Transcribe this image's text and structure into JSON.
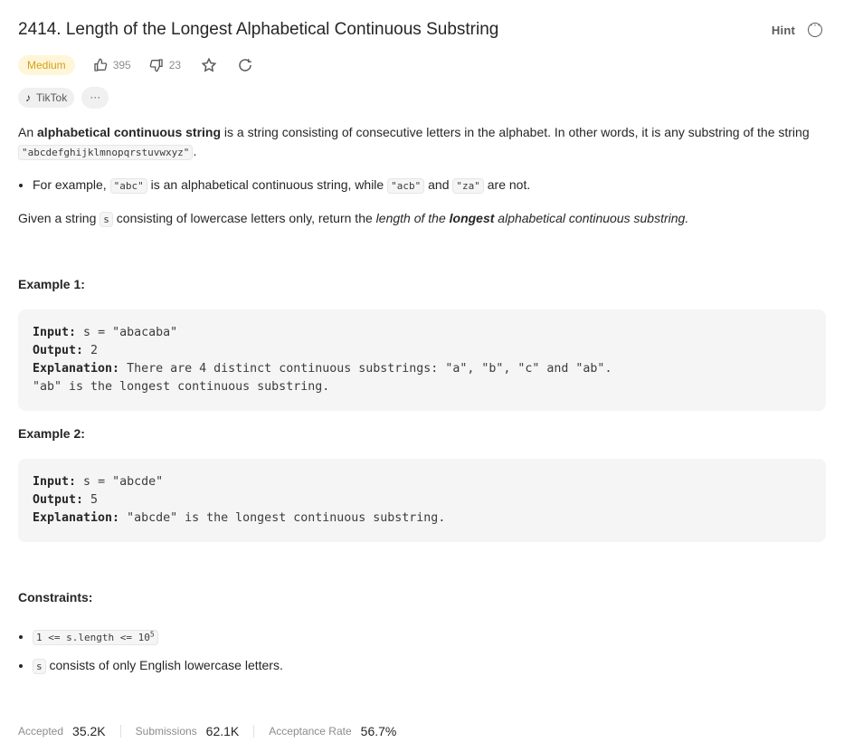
{
  "problem": {
    "title": "2414. Length of the Longest Alphabetical Continuous Substring",
    "hint_label": "Hint",
    "difficulty": "Medium",
    "likes": "395",
    "dislikes": "23",
    "tags": [
      "TikTok"
    ],
    "tag_more": "···"
  },
  "description": {
    "p1_a": "An ",
    "p1_bold": "alphabetical continuous string",
    "p1_b": " is a string consisting of consecutive letters in the alphabet. In other words, it is any substring of the string ",
    "p1_code": "\"abcdefghijklmnopqrstuvwxyz\"",
    "p1_end": ".",
    "bullet_a": "For example, ",
    "bullet_code1": "\"abc\"",
    "bullet_b": " is an alphabetical continuous string, while ",
    "bullet_code2": "\"acb\"",
    "bullet_c": " and ",
    "bullet_code3": "\"za\"",
    "bullet_d": " are not.",
    "p2_a": "Given a string ",
    "p2_code": "s",
    "p2_b": " consisting of lowercase letters only, return the ",
    "p2_italic1": "length of the ",
    "p2_bolditalic": "longest",
    "p2_italic2": " alphabetical continuous substring.",
    "p2_end": ""
  },
  "examples": [
    {
      "label": "Example 1:",
      "input_label": "Input:",
      "input": " s = \"abacaba\"",
      "output_label": "Output:",
      "output": " 2",
      "explanation_label": "Explanation:",
      "explanation": " There are 4 distinct continuous substrings: \"a\", \"b\", \"c\" and \"ab\".",
      "explanation_2": "\"ab\" is the longest continuous substring."
    },
    {
      "label": "Example 2:",
      "input_label": "Input:",
      "input": " s = \"abcde\"",
      "output_label": "Output:",
      "output": " 5",
      "explanation_label": "Explanation:",
      "explanation": " \"abcde\" is the longest continuous substring."
    }
  ],
  "constraints": {
    "label": "Constraints:",
    "c1_code": "1 <= s.length <= 10",
    "c1_sup": "5",
    "c2_code": "s",
    "c2_text": " consists of only English lowercase letters."
  },
  "stats": {
    "accepted_label": "Accepted",
    "accepted": "35.2K",
    "submissions_label": "Submissions",
    "submissions": "62.1K",
    "rate_label": "Acceptance Rate",
    "rate": "56.7%"
  },
  "colors": {
    "medium_badge_bg": "#fff6d9",
    "medium_badge_text": "#d4a016",
    "code_bg": "#f5f5f5"
  }
}
